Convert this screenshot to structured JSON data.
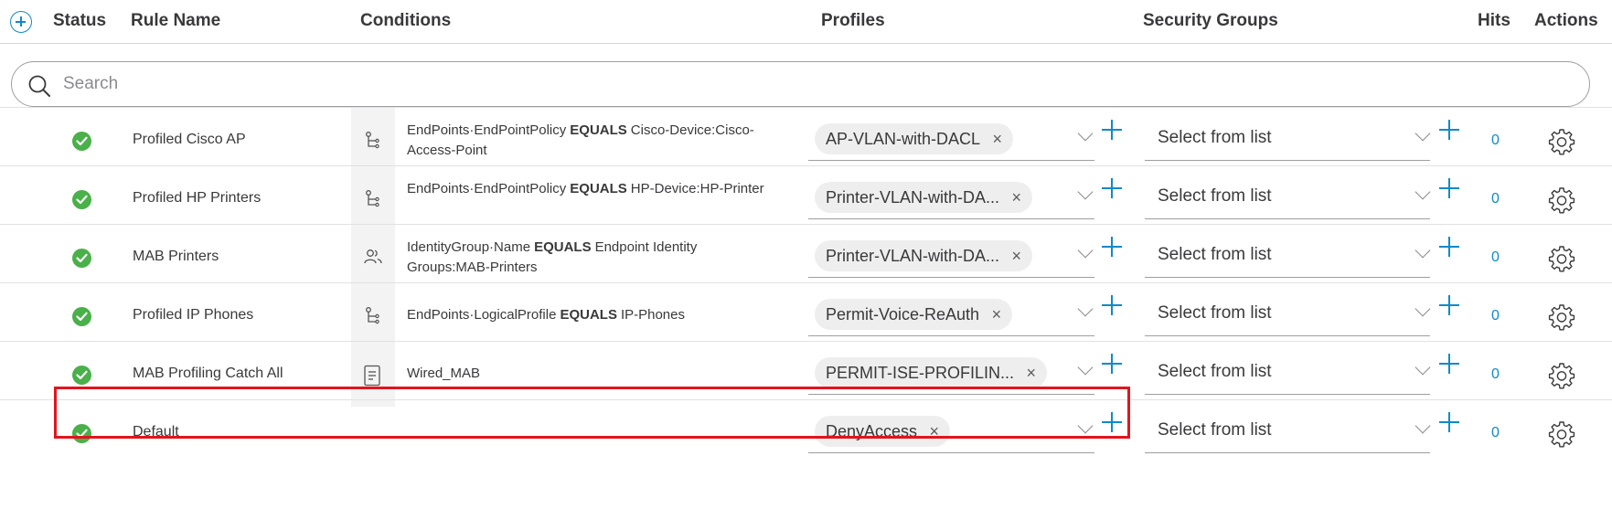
{
  "header": {
    "columns": {
      "status": "Status",
      "rule_name": "Rule Name",
      "conditions": "Conditions",
      "profiles": "Profiles",
      "security_groups": "Security Groups",
      "hits": "Hits",
      "actions": "Actions"
    }
  },
  "search": {
    "placeholder": "Search"
  },
  "colors": {
    "accent": "#0d8ac7",
    "success": "#4ab04a",
    "highlight": "#e2141d"
  },
  "rows": [
    {
      "status": "enabled",
      "name": "Profiled Cisco AP",
      "condition_icon": "endpoint-tree-icon",
      "condition": {
        "attr": "EndPoints·EndPointPolicy",
        "op": "EQUALS",
        "value": "Cisco-Device:Cisco-Access-Point"
      },
      "profile": "AP-VLAN-with-DACL",
      "security_group": "Select from list",
      "hits": "0"
    },
    {
      "status": "enabled",
      "name": "Profiled HP Printers",
      "condition_icon": "endpoint-tree-icon",
      "condition": {
        "attr": "EndPoints·EndPointPolicy",
        "op": "EQUALS",
        "value": "HP-Device:HP-Printer"
      },
      "profile": "Printer-VLAN-with-DA...",
      "security_group": "Select from list",
      "hits": "0"
    },
    {
      "status": "enabled",
      "name": "MAB Printers",
      "condition_icon": "identity-group-icon",
      "condition": {
        "attr": "IdentityGroup·Name",
        "op": "EQUALS",
        "value": "Endpoint Identity Groups:MAB-Printers"
      },
      "profile": "Printer-VLAN-with-DA...",
      "security_group": "Select from list",
      "hits": "0"
    },
    {
      "status": "enabled",
      "name": "Profiled IP Phones",
      "condition_icon": "endpoint-tree-icon",
      "condition": {
        "attr": "EndPoints·LogicalProfile",
        "op": "EQUALS",
        "value": "IP-Phones"
      },
      "profile": "Permit-Voice-ReAuth",
      "security_group": "Select from list",
      "hits": "0"
    },
    {
      "status": "enabled",
      "name": "MAB Profiling Catch All",
      "condition_icon": "library-condition-icon",
      "condition": {
        "attr": "Wired_MAB",
        "op": "",
        "value": ""
      },
      "profile": "PERMIT-ISE-PROFILIN...",
      "security_group": "Select from list",
      "hits": "0"
    },
    {
      "status": "enabled",
      "name": "Default",
      "condition_icon": "",
      "condition": {
        "attr": "",
        "op": "",
        "value": ""
      },
      "profile": "DenyAccess",
      "security_group": "Select from list",
      "hits": "0"
    }
  ]
}
